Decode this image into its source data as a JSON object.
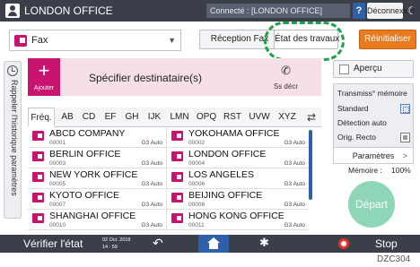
{
  "topbar": {
    "title": "LONDON OFFICE",
    "connection": "Connecté : [LONDON OFFICE]",
    "help_label": "?",
    "logout_label": "Déconnexion",
    "user_icon": "user-icon",
    "moon_icon": "moon-icon"
  },
  "function": {
    "app_label": "Fax",
    "app_icon": "fax-icon",
    "reception_label": "Réception Fax",
    "etat_label": "État des travaux",
    "reset_label": "Réinitialiser"
  },
  "sidebar": {
    "history_label": "Rappeler l'historique paramètres"
  },
  "destination": {
    "add_label": "Ajouter",
    "field_label": "Spécifier destinataire(s)",
    "ssdecr_label": "Ss décr"
  },
  "index_tabs": [
    "Fréq.",
    "AB",
    "CD",
    "EF",
    "GH",
    "IJK",
    "LMN",
    "OPQ",
    "RST",
    "UVW",
    "XYZ"
  ],
  "address_list": [
    {
      "name": "ABCD COMPANY",
      "number": "00001",
      "mode": "G3 Auto"
    },
    {
      "name": "YOKOHAMA OFFICE",
      "number": "00002",
      "mode": "G3 Auto"
    },
    {
      "name": "BERLIN OFFICE",
      "number": "00003",
      "mode": "G3 Auto"
    },
    {
      "name": "LONDON OFFICE",
      "number": "00004",
      "mode": "G3 Auto"
    },
    {
      "name": "NEW YORK OFFICE",
      "number": "00005",
      "mode": "G3 Auto"
    },
    {
      "name": "LOS ANGELES",
      "number": "00006",
      "mode": "G3 Auto"
    },
    {
      "name": "KYOTO OFFICE",
      "number": "00007",
      "mode": "G3 Auto"
    },
    {
      "name": "BEIJING OFFICE",
      "number": "00008",
      "mode": "G3 Auto"
    },
    {
      "name": "SHANGHAI OFFICE",
      "number": "00010",
      "mode": "G3 Auto"
    },
    {
      "name": "HONG KONG OFFICE",
      "number": "00011",
      "mode": "G3 Auto"
    }
  ],
  "settings": {
    "apercu_label": "Aperçu",
    "transmission_label": "Transmiss° mémoire",
    "resolution_label": "Standard",
    "density_label": "Détection auto",
    "original_label": "Orig. Recto",
    "params_label": "Paramètres",
    "memory_label": "Mémoire :",
    "memory_value": "100%",
    "start_label": "Départ"
  },
  "bottombar": {
    "check_status_label": "Vérifier l'état",
    "date": "02 Oct. 2018",
    "time": "14 : 59",
    "stop_label": "Stop"
  },
  "caption": "DZC304",
  "colors": {
    "accent_magenta": "#c8146e",
    "reset_orange": "#e87a1f",
    "callout_green": "#1fa04a",
    "start_green": "#8fd6b8",
    "dark_bar": "#3b3f4a",
    "home_blue": "#2e5fa8"
  }
}
